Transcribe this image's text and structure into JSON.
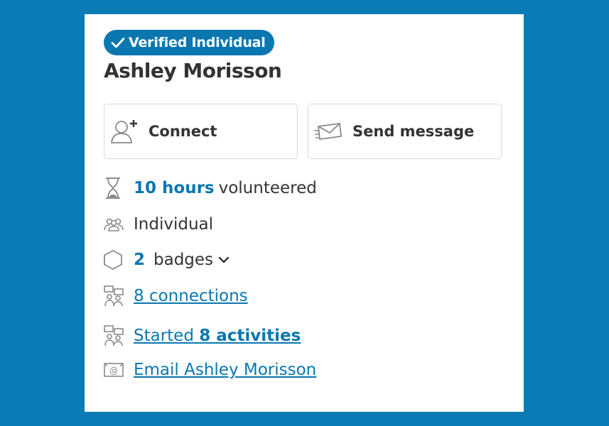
{
  "colors": {
    "background": "#0a7bb4",
    "accent": "#0a77b0",
    "text": "#333333",
    "icon": "#8a8a8a"
  },
  "profile": {
    "badge_label": "Verified Individual",
    "name": "Ashley Morisson"
  },
  "actions": {
    "connect_label": "Connect",
    "message_label": "Send message"
  },
  "stats": {
    "hours_value": "10 hours",
    "hours_suffix": "volunteered",
    "type": "Individual",
    "badges_count": "2",
    "badges_label": "badges",
    "connections_link": "8 connections",
    "activities_prefix": "Started",
    "activities_link": "8 activities",
    "email_link": "Email Ashley Morisson"
  },
  "icons": [
    "check-icon",
    "add-user-icon",
    "envelope-icon",
    "hourglass-icon",
    "group-icon",
    "hexagon-icon",
    "chevron-down-icon",
    "network-icon",
    "network-icon",
    "email-at-icon"
  ]
}
